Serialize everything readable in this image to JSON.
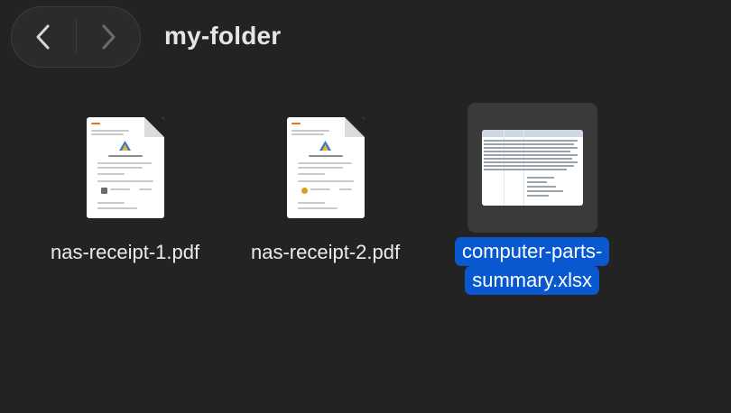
{
  "toolbar": {
    "back_icon": "chevron-left-icon",
    "forward_icon": "chevron-right-icon",
    "folder_title": "my-folder"
  },
  "files": [
    {
      "name": "nas-receipt-1.pdf",
      "kind": "pdf",
      "selected": false
    },
    {
      "name": "nas-receipt-2.pdf",
      "kind": "pdf",
      "selected": false
    },
    {
      "name_lines": [
        "computer-parts-",
        "summary.xlsx"
      ],
      "kind": "xlsx",
      "selected": true
    }
  ],
  "colors": {
    "background": "#232323",
    "selection": "#0a58d0",
    "selected_tile": "#3a3a3a"
  }
}
